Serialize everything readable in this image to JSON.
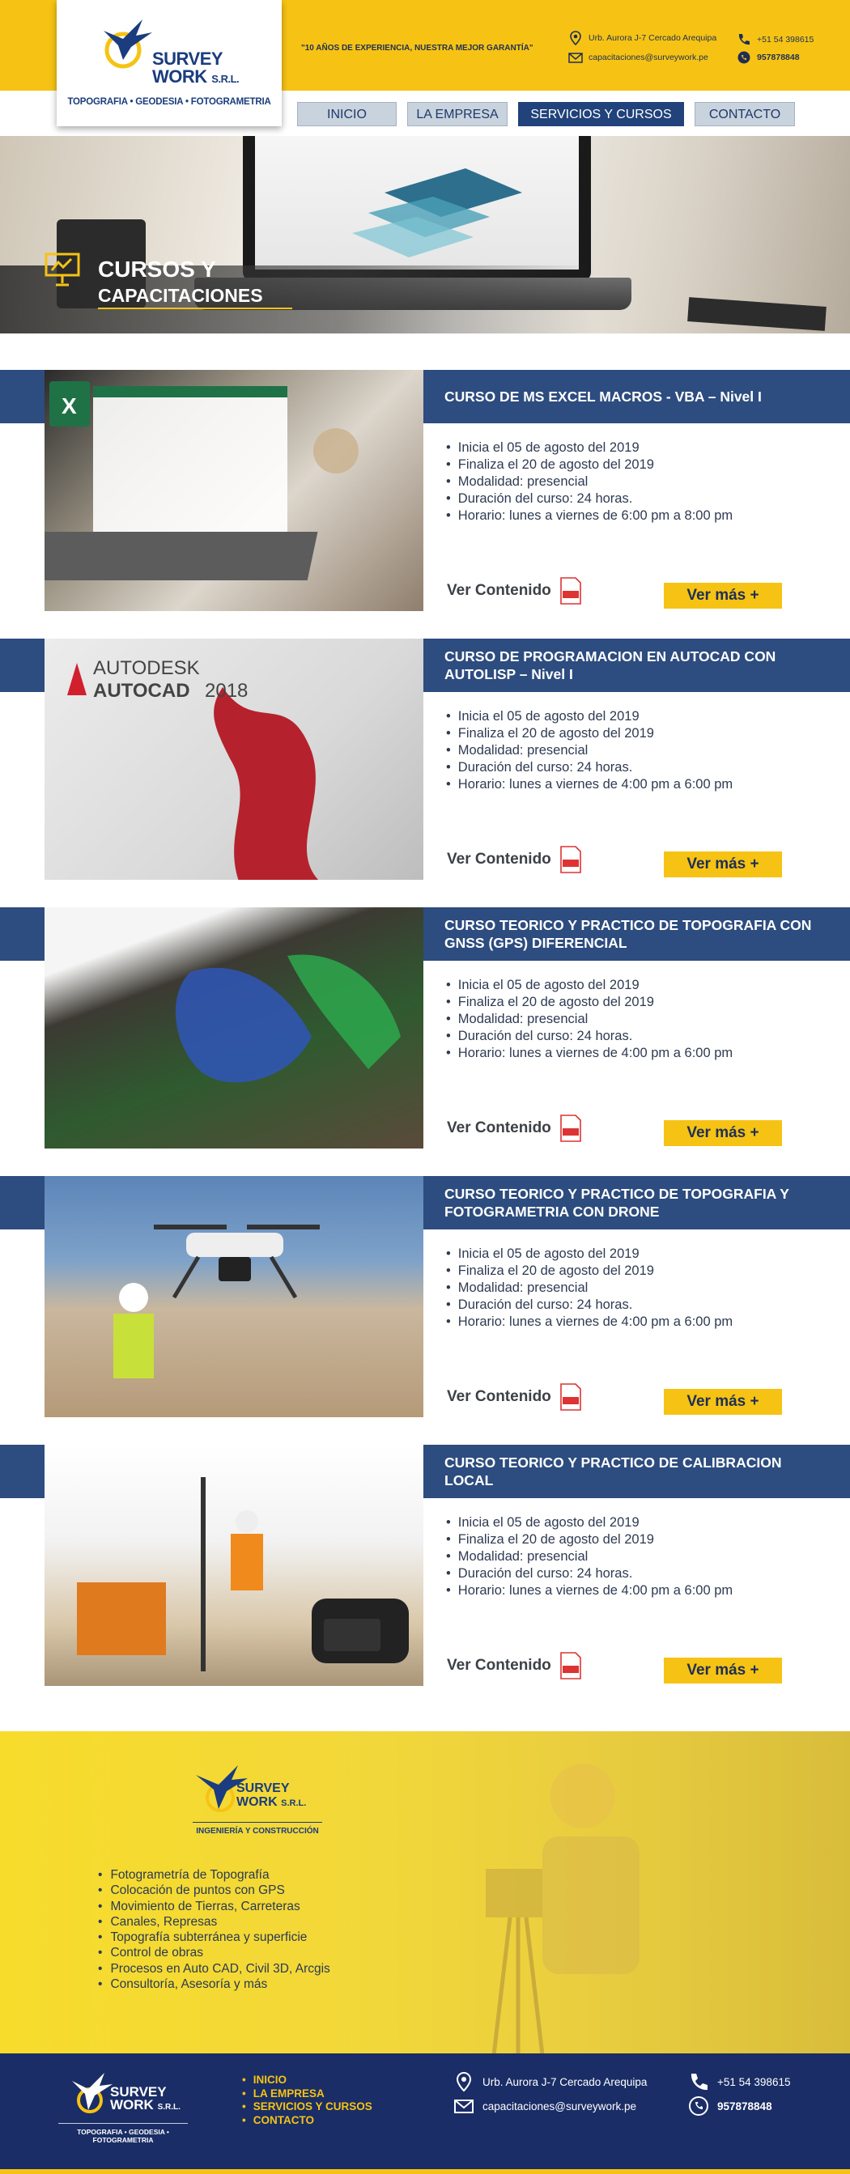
{
  "brand": {
    "name": "SURVEY",
    "name2": "WORK",
    "suffix": "S.R.L.",
    "tagline": "TOPOGRAFIA • GEODESIA • FOTOGRAMETRIA",
    "slogan": "\"10 AÑOS DE EXPERIENCIA, NUESTRA MEJOR GARANTÍA\"",
    "promo_tagline": "INGENIERÍA Y CONSTRUCCIÓN",
    "footer_tagline": "TOPOGRAFIA • GEODESIA • FOTOGRAMETRIA"
  },
  "contact": {
    "address": "Urb. Aurora J-7 Cercado Arequipa",
    "email": "capacitaciones@surveywork.pe",
    "phone": "+51 54 398615",
    "whatsapp": "957878848"
  },
  "nav": [
    "INICIO",
    "LA EMPRESA",
    "SERVICIOS Y CURSOS",
    "CONTACTO"
  ],
  "hero": {
    "title_line1": "CURSOS Y",
    "title_line2": "CAPACITACIONES"
  },
  "course_actions": {
    "ver_contenido": "Ver Contenido",
    "ver_mas": "Ver más +"
  },
  "courses": [
    {
      "title": "CURSO DE MS EXCEL MACROS - VBA – Nivel I",
      "details": [
        "Inicia el 05 de agosto del 2019",
        "Finaliza el 20 de agosto del 2019",
        "Modalidad: presencial",
        "Duración del curso: 24 horas.",
        "Horario: lunes a viernes de 6:00 pm a 8:00 pm"
      ]
    },
    {
      "title": "CURSO DE PROGRAMACION EN AUTOCAD CON AUTOLISP – Nivel I",
      "details": [
        "Inicia el 05 de agosto del 2019",
        "Finaliza el 20 de agosto del 2019",
        "Modalidad: presencial",
        "Duración del curso: 24 horas.",
        "Horario: lunes a viernes de 4:00 pm a 6:00 pm"
      ],
      "image_text": {
        "line1": "AUTODESK",
        "line2": "AUTOCAD",
        "year": "2018"
      }
    },
    {
      "title": "CURSO TEORICO Y PRACTICO DE TOPOGRAFIA CON GNSS (GPS) DIFERENCIAL",
      "details": [
        "Inicia el 05 de agosto del 2019",
        "Finaliza el 20 de agosto del 2019",
        "Modalidad: presencial",
        "Duración del curso: 24 horas.",
        "Horario: lunes a viernes de 4:00 pm a 6:00 pm"
      ]
    },
    {
      "title": "CURSO TEORICO Y PRACTICO DE TOPOGRAFIA Y FOTOGRAMETRIA CON DRONE",
      "details": [
        "Inicia el 05 de agosto del 2019",
        "Finaliza el 20 de agosto del 2019",
        "Modalidad: presencial",
        "Duración del curso: 24 horas.",
        "Horario: lunes a viernes de 4:00 pm a 6:00 pm"
      ]
    },
    {
      "title": "CURSO TEORICO Y PRACTICO DE CALIBRACION LOCAL",
      "details": [
        "Inicia el 05 de agosto del 2019",
        "Finaliza el 20 de agosto del 2019",
        "Modalidad: presencial",
        "Duración del curso: 24 horas.",
        "Horario: lunes a viernes de 4:00 pm a 6:00 pm"
      ]
    }
  ],
  "services": [
    "Fotogrametría de Topografía",
    "Colocación de puntos con GPS",
    "Movimiento de Tierras, Carreteras",
    "Canales, Represas",
    "Topografía subterránea y superficie",
    "Control de obras",
    "Procesos en Auto CAD, Civil 3D, Arcgis",
    "Consultoría, Asesoría y más"
  ],
  "footer_links": [
    "INICIO",
    "LA EMPRESA",
    "SERVICIOS Y CURSOS",
    "CONTACTO"
  ],
  "colors": {
    "yellow": "#f6c314",
    "navy": "#1a2d66",
    "band": "#2d4c7f"
  }
}
